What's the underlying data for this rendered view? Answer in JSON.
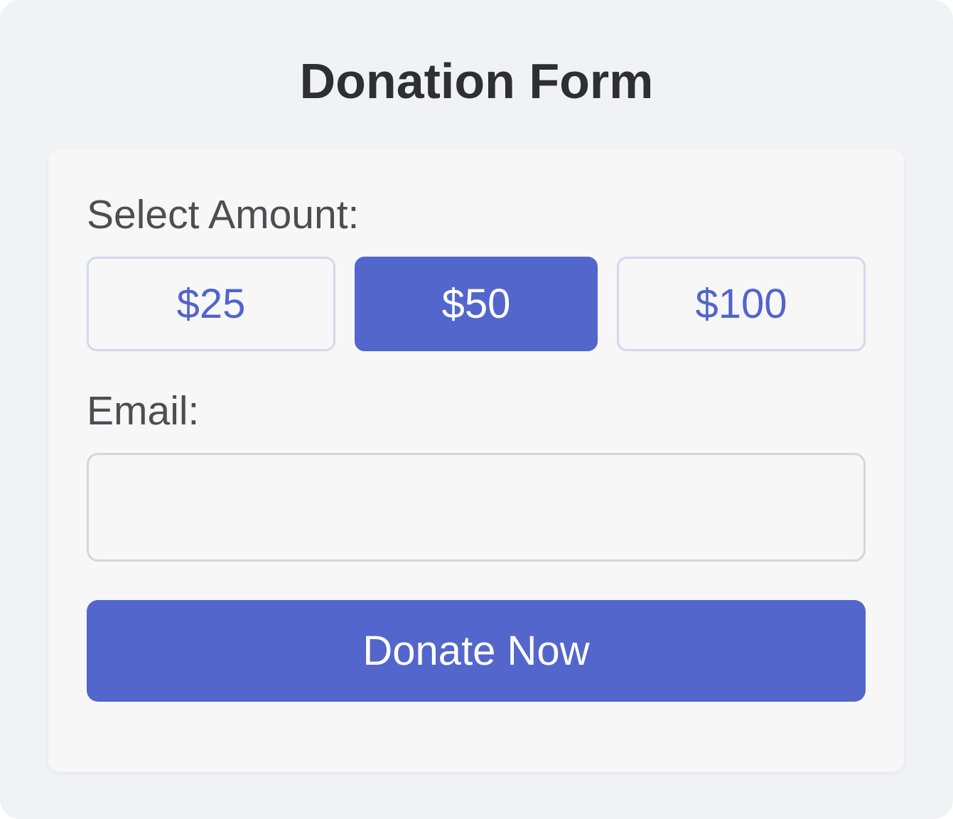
{
  "form": {
    "title": "Donation Form",
    "amount_label": "Select Amount:",
    "amount_options": [
      "$25",
      "$50",
      "$100"
    ],
    "selected_amount": "$50",
    "email_label": "Email:",
    "email_value": "",
    "email_placeholder": "",
    "submit_label": "Donate Now"
  },
  "colors": {
    "accent": "#5266cc",
    "page_background": "#f1f2f6",
    "card_background": "#f7f7f7",
    "title_text": "#2f2f33",
    "label_text": "#4e4e52",
    "option_border": "#d4d8ea",
    "input_border": "#d6d6d6"
  }
}
